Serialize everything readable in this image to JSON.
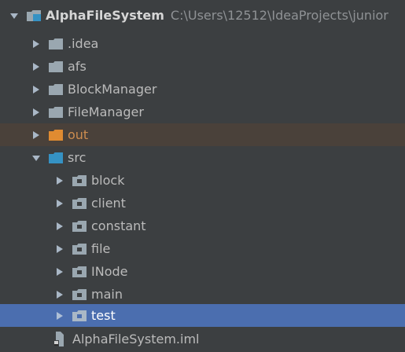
{
  "project_tree": {
    "root": {
      "name": "AlphaFileSystem",
      "path": "C:\\Users\\12512\\IdeaProjects\\junior"
    },
    "items": [
      {
        "label": ".idea",
        "icon": "folder-icon",
        "expanded": false
      },
      {
        "label": "afs",
        "icon": "folder-icon",
        "expanded": false
      },
      {
        "label": "BlockManager",
        "icon": "folder-icon",
        "expanded": false
      },
      {
        "label": "FileManager",
        "icon": "folder-icon",
        "expanded": false
      },
      {
        "label": "out",
        "icon": "excluded-folder-icon",
        "expanded": false
      },
      {
        "label": "src",
        "icon": "source-folder-icon",
        "expanded": true
      }
    ],
    "packages": [
      {
        "label": "block",
        "icon": "package-icon"
      },
      {
        "label": "client",
        "icon": "package-icon"
      },
      {
        "label": "constant",
        "icon": "package-icon"
      },
      {
        "label": "file",
        "icon": "package-icon"
      },
      {
        "label": "INode",
        "icon": "package-icon"
      },
      {
        "label": "main",
        "icon": "package-icon"
      },
      {
        "label": "test",
        "icon": "package-icon",
        "selected": true
      }
    ],
    "file": {
      "label": "AlphaFileSystem.iml",
      "icon": "module-file-icon"
    }
  },
  "colors": {
    "background": "#3c3f41",
    "selection": "#4b6eaf",
    "out_row_background": "#4a413a",
    "out_text": "#cc8c4f",
    "folder_gray": "#9aa7b0",
    "source_blue": "#3592c4",
    "out_orange": "#e08b31"
  }
}
